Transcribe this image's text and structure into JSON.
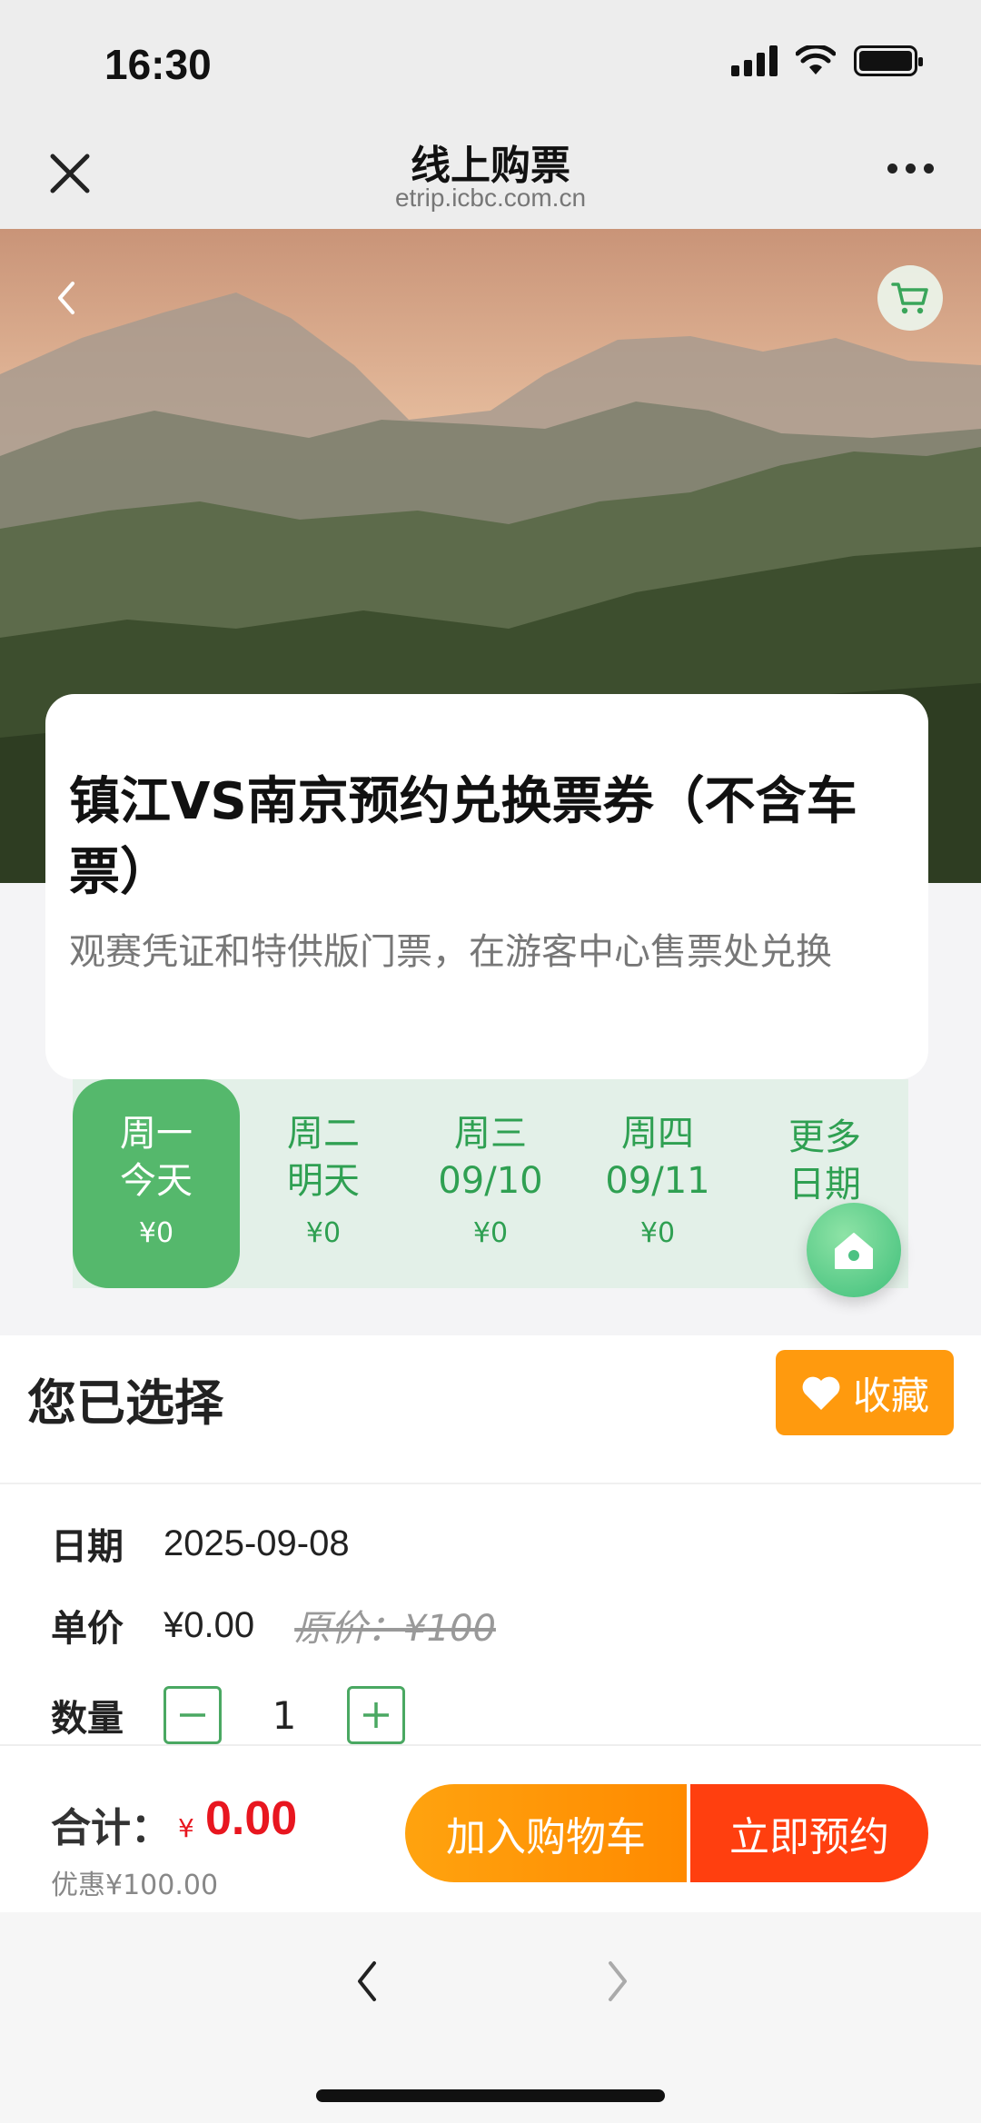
{
  "status": {
    "time": "16:30"
  },
  "nav": {
    "title": "线上购票",
    "url": "etrip.icbc.com.cn"
  },
  "product": {
    "title": "镇江VS南京预约兑换票券（不含车票）",
    "subtitle": "观赛凭证和特供版门票，在游客中心售票处兑换"
  },
  "dates": [
    {
      "line1": "周一",
      "line2": "今天",
      "price": "¥0",
      "active": true
    },
    {
      "line1": "周二",
      "line2": "明天",
      "price": "¥0",
      "active": false
    },
    {
      "line1": "周三",
      "line2": "09/10",
      "price": "¥0",
      "active": false
    },
    {
      "line1": "周四",
      "line2": "09/11",
      "price": "¥0",
      "active": false
    },
    {
      "line1": "更多",
      "line2": "日期",
      "price": "",
      "active": false
    }
  ],
  "selection": {
    "title": "您已选择",
    "favorite_label": "收藏",
    "date_label": "日期",
    "date_value": "2025-09-08",
    "price_label": "单价",
    "price_value": "¥0.00",
    "original_price": "原价：¥100",
    "qty_label": "数量",
    "qty_value": "1"
  },
  "footer": {
    "total_label": "合计：",
    "currency": "¥",
    "total_value": "0.00",
    "discount": "优惠¥100.00",
    "add_cart_label": "加入购物车",
    "reserve_label": "立即预约"
  },
  "colors": {
    "green": "#2fa052",
    "orange": "#ff9a0e",
    "red": "#ff3f0f",
    "price_red": "#e8161f"
  }
}
